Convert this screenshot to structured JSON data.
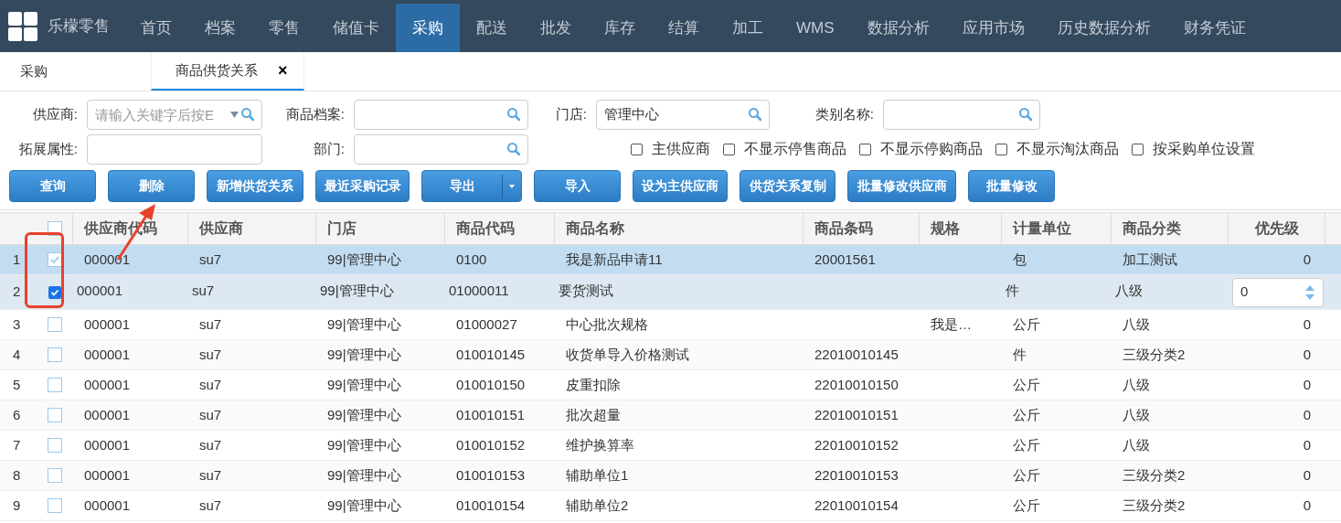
{
  "nav": {
    "brand": "乐檬零售",
    "items": [
      {
        "label": "首页",
        "selected": false
      },
      {
        "label": "档案",
        "selected": false
      },
      {
        "label": "零售",
        "selected": false
      },
      {
        "label": "储值卡",
        "selected": false
      },
      {
        "label": "采购",
        "selected": true
      },
      {
        "label": "配送",
        "selected": false
      },
      {
        "label": "批发",
        "selected": false
      },
      {
        "label": "库存",
        "selected": false
      },
      {
        "label": "结算",
        "selected": false
      },
      {
        "label": "加工",
        "selected": false
      },
      {
        "label": "WMS",
        "selected": false
      },
      {
        "label": "数据分析",
        "selected": false
      },
      {
        "label": "应用市场",
        "selected": false
      },
      {
        "label": "历史数据分析",
        "selected": false
      },
      {
        "label": "财务凭证",
        "selected": false
      }
    ]
  },
  "page_tabs": [
    {
      "label": "采购",
      "selected": false
    },
    {
      "label": "商品供货关系",
      "selected": true,
      "close": "×"
    }
  ],
  "filters": [
    [
      {
        "label": "供应商:",
        "placeholder": "请输入关键字后按E",
        "dropdown": true
      },
      {
        "label": "商品档案:"
      },
      {
        "label": "门店:",
        "value": "管理中心"
      },
      {
        "label": "类别名称:"
      }
    ],
    [
      {
        "label": "拓展属性:",
        "search": false
      },
      {
        "label": "部门:"
      }
    ]
  ],
  "options": [
    {
      "label": "主供应商",
      "checked": false
    },
    {
      "label": "不显示停售商品",
      "checked": false
    },
    {
      "label": "不显示停购商品",
      "checked": false
    },
    {
      "label": "不显示淘汰商品",
      "checked": false
    },
    {
      "label": "按采购单位设置",
      "checked": false
    }
  ],
  "buttons": [
    {
      "label": "查询"
    },
    {
      "label": "删除"
    },
    {
      "label": "新增供货关系"
    },
    {
      "label": "最近采购记录"
    },
    {
      "label": "导出",
      "split": true
    },
    {
      "label": "导入"
    },
    {
      "label": "设为主供应商"
    },
    {
      "label": "供货关系复制"
    },
    {
      "label": "批量修改供应商"
    },
    {
      "label": "批量修改"
    }
  ],
  "table": {
    "header_checked": false,
    "columns": [
      "供应商代码",
      "供应商",
      "门店",
      "商品代码",
      "商品名称",
      "商品条码",
      "规格",
      "计量单位",
      "商品分类",
      "优先级"
    ],
    "rows": [
      {
        "no": "1",
        "checked": true,
        "selected": true,
        "editing": false,
        "cells": [
          "000001",
          "su7",
          "99|管理中心",
          "0100",
          "我是新品申请11",
          "20001561",
          "",
          "包",
          "加工测试",
          "0"
        ]
      },
      {
        "no": "2",
        "checked": true,
        "selected": false,
        "editing": true,
        "cells": [
          "000001",
          "su7",
          "99|管理中心",
          "01000011",
          "要货测试",
          "",
          "",
          "件",
          "八级",
          "0"
        ]
      },
      {
        "no": "3",
        "checked": false,
        "selected": false,
        "editing": false,
        "cells": [
          "000001",
          "su7",
          "99|管理中心",
          "01000027",
          "中心批次规格",
          "",
          "我是…",
          "公斤",
          "八级",
          "0"
        ]
      },
      {
        "no": "4",
        "checked": false,
        "selected": false,
        "editing": false,
        "cells": [
          "000001",
          "su7",
          "99|管理中心",
          "010010145",
          "收货单导入价格测试",
          "22010010145",
          "",
          "件",
          "三级分类2",
          "0"
        ]
      },
      {
        "no": "5",
        "checked": false,
        "selected": false,
        "editing": false,
        "cells": [
          "000001",
          "su7",
          "99|管理中心",
          "010010150",
          "皮重扣除",
          "22010010150",
          "",
          "公斤",
          "八级",
          "0"
        ]
      },
      {
        "no": "6",
        "checked": false,
        "selected": false,
        "editing": false,
        "cells": [
          "000001",
          "su7",
          "99|管理中心",
          "010010151",
          "批次超量",
          "22010010151",
          "",
          "公斤",
          "八级",
          "0"
        ]
      },
      {
        "no": "7",
        "checked": false,
        "selected": false,
        "editing": false,
        "cells": [
          "000001",
          "su7",
          "99|管理中心",
          "010010152",
          "维护换算率",
          "22010010152",
          "",
          "公斤",
          "八级",
          "0"
        ]
      },
      {
        "no": "8",
        "checked": false,
        "selected": false,
        "editing": false,
        "cells": [
          "000001",
          "su7",
          "99|管理中心",
          "010010153",
          "辅助单位1",
          "22010010153",
          "",
          "公斤",
          "三级分类2",
          "0"
        ]
      },
      {
        "no": "9",
        "checked": false,
        "selected": false,
        "editing": false,
        "cells": [
          "000001",
          "su7",
          "99|管理中心",
          "010010154",
          "辅助单位2",
          "22010010154",
          "",
          "公斤",
          "三级分类2",
          "0"
        ]
      }
    ]
  }
}
